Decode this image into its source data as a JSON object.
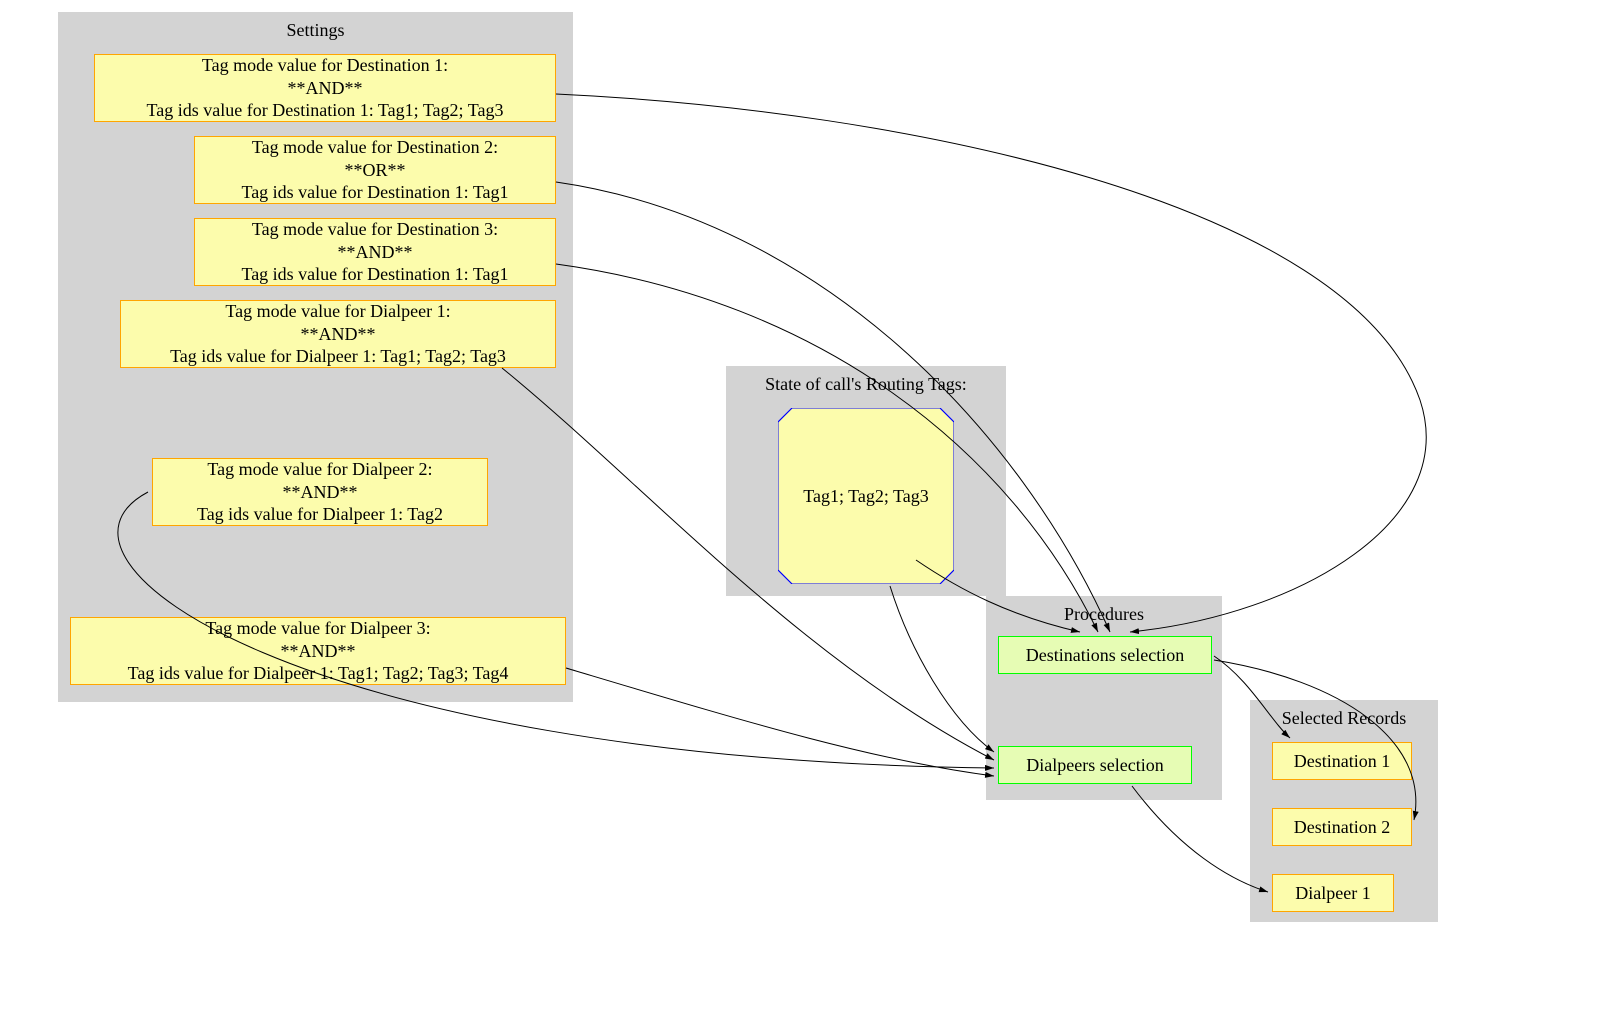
{
  "clusters": {
    "settings": {
      "title": "Settings"
    },
    "state": {
      "title": "State of call's Routing Tags:"
    },
    "procedures": {
      "title": "Procedures"
    },
    "selected": {
      "title": "Selected Records"
    }
  },
  "settings_nodes": {
    "dest1": "Tag mode value for Destination 1:\n**AND**\nTag ids value for Destination 1: Tag1; Tag2; Tag3",
    "dest2": "Tag mode value for Destination 2:\n**OR**\nTag ids value for Destination 1: Tag1",
    "dest3": "Tag mode value for Destination 3:\n**AND**\nTag ids value for Destination 1: Tag1",
    "dial1": "Tag mode value for Dialpeer 1:\n**AND**\nTag ids value for Dialpeer 1: Tag1; Tag2; Tag3",
    "dial2": "Tag mode value for Dialpeer 2:\n**AND**\nTag ids value for Dialpeer 1: Tag2",
    "dial3": "Tag mode value for Dialpeer 3:\n**AND**\nTag ids value for Dialpeer 1: Tag1; Tag2; Tag3; Tag4"
  },
  "state_node": "Tag1; Tag2; Tag3",
  "procedures_nodes": {
    "dest_sel": "Destinations selection",
    "dial_sel": "Dialpeers selection"
  },
  "selected_nodes": {
    "sel_dest1": "Destination 1",
    "sel_dest2": "Destination 2",
    "sel_dial1": "Dialpeer 1"
  }
}
